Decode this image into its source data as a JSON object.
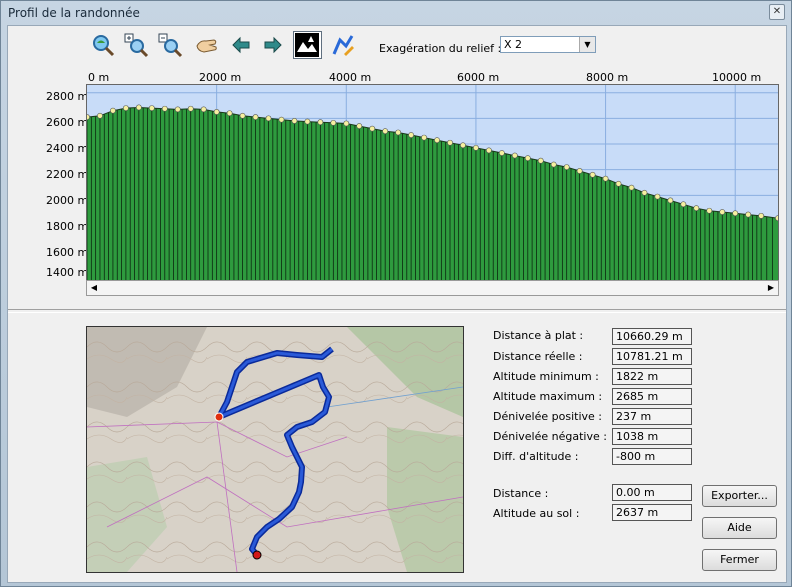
{
  "window": {
    "title": "Profil de la randonnée",
    "close_glyph": "✕"
  },
  "toolbar": {
    "tools": [
      "zoom-fit-icon",
      "zoom-in-icon",
      "zoom-out-icon",
      "pan-hand-icon",
      "arrow-left-icon",
      "arrow-right-icon",
      "landscape-trees-icon",
      "path-edit-icon"
    ],
    "relief_label": "Exagération du relief :",
    "relief_value": "X 2"
  },
  "chart_data": {
    "type": "area",
    "title": "",
    "xlabel": "",
    "ylabel": "",
    "x_ticks": [
      "0 m",
      "2000 m",
      "4000 m",
      "6000 m",
      "8000 m",
      "10000 m"
    ],
    "y_ticks": [
      "2800 m",
      "2600 m",
      "2400 m",
      "2200 m",
      "2000 m",
      "1800 m",
      "1600 m",
      "1400 m"
    ],
    "xlim": [
      0,
      10660
    ],
    "ylim": [
      1340,
      2860
    ],
    "grid": true,
    "fill_color": "#2e9b3e",
    "line_color": "#000000",
    "marker_color": "#f5f0a0",
    "x": [
      0,
      200,
      400,
      600,
      800,
      1000,
      1200,
      1400,
      1600,
      1800,
      2000,
      2200,
      2400,
      2600,
      2800,
      3000,
      3200,
      3400,
      3600,
      3800,
      4000,
      4200,
      4400,
      4600,
      4800,
      5000,
      5200,
      5400,
      5600,
      5800,
      6000,
      6200,
      6400,
      6600,
      6800,
      7000,
      7200,
      7400,
      7600,
      7800,
      8000,
      8200,
      8400,
      8600,
      8800,
      9000,
      9200,
      9400,
      9600,
      9800,
      10000,
      10200,
      10400,
      10660
    ],
    "y": [
      2610,
      2620,
      2660,
      2680,
      2685,
      2680,
      2675,
      2670,
      2675,
      2670,
      2650,
      2640,
      2620,
      2610,
      2600,
      2590,
      2580,
      2575,
      2570,
      2565,
      2560,
      2540,
      2520,
      2500,
      2490,
      2470,
      2450,
      2430,
      2410,
      2390,
      2370,
      2350,
      2330,
      2310,
      2290,
      2270,
      2240,
      2220,
      2190,
      2160,
      2130,
      2090,
      2060,
      2020,
      1990,
      1960,
      1930,
      1900,
      1880,
      1870,
      1860,
      1850,
      1840,
      1822
    ]
  },
  "map": {
    "route_color": "#2a5ad8",
    "start_marker_color": "#e03010",
    "end_marker_color": "#d01818"
  },
  "stats": [
    {
      "label": "Distance à plat :",
      "value": "10660.29 m"
    },
    {
      "label": "Distance réelle :",
      "value": "10781.21 m"
    },
    {
      "label": "Altitude minimum :",
      "value": "1822 m"
    },
    {
      "label": "Altitude maximum :",
      "value": "2685 m"
    },
    {
      "label": "Dénivelée positive :",
      "value": "237 m"
    },
    {
      "label": "Dénivelée négative :",
      "value": "1038 m"
    },
    {
      "label": "Diff. d'altitude :",
      "value": "-800 m"
    }
  ],
  "cursor": [
    {
      "label": "Distance :",
      "value": "0.00 m"
    },
    {
      "label": "Altitude au sol :",
      "value": "2637 m"
    }
  ],
  "buttons": {
    "export": "Exporter...",
    "help": "Aide",
    "close": "Fermer"
  }
}
